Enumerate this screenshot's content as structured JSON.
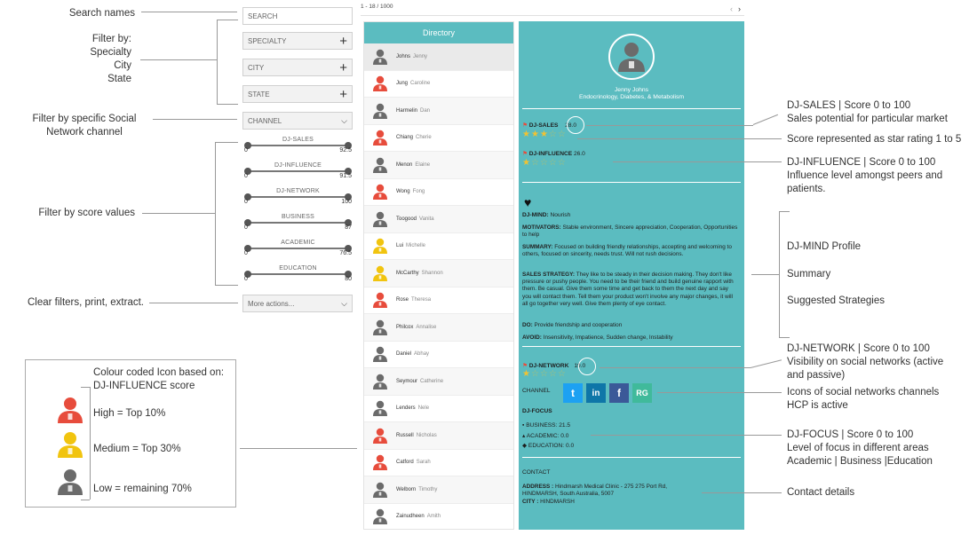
{
  "annotations": {
    "search_names": "Search names",
    "filter_by": "Filter by:",
    "specialty": "Specialty",
    "city": "City",
    "state": "State",
    "filter_channel_1": "Filter by specific Social",
    "filter_channel_2": "Network channel",
    "filter_score": "Filter by score values",
    "clear_filters": "Clear filters, print, extract.",
    "dj_sales_1": "DJ-SALES | Score 0 to 100",
    "dj_sales_2": "Sales potential for particular market",
    "star_rating": "Score represented as star rating 1 to 5",
    "dj_influence_1": "DJ-INFLUENCE | Score 0 to 100",
    "dj_influence_2": "Influence level amongst peers and",
    "dj_influence_3": "patients.",
    "dj_mind_profile": "DJ-MIND Profile",
    "summary": "Summary",
    "suggested": "Suggested Strategies",
    "dj_network_1": "DJ-NETWORK | Score 0 to 100",
    "dj_network_2": "Visibility on social networks (active",
    "dj_network_3": "and passive)",
    "icons_1": "Icons of social networks channels",
    "icons_2": "HCP is active",
    "dj_focus_1": "DJ-FOCUS | Score 0 to 100",
    "dj_focus_2": "Level of focus in different areas",
    "dj_focus_3": "Academic | Business |Education",
    "contact_details": "Contact details"
  },
  "filters": {
    "search_placeholder": "SEARCH",
    "specialty": "SPECIALTY",
    "city": "CITY",
    "state": "STATE",
    "channel": "CHANNEL",
    "more_actions": "More actions..."
  },
  "sliders": [
    {
      "label": "DJ-SALES",
      "min": "0",
      "max": "92.5"
    },
    {
      "label": "DJ-INFLUENCE",
      "min": "0",
      "max": "91.5"
    },
    {
      "label": "DJ-NETWORK",
      "min": "0",
      "max": "100"
    },
    {
      "label": "BUSINESS",
      "min": "0",
      "max": "87"
    },
    {
      "label": "ACADEMIC",
      "min": "0",
      "max": "76.5"
    },
    {
      "label": "EDUCATION",
      "min": "0",
      "max": "80"
    }
  ],
  "pager": {
    "range": "1 - 18 / 1000",
    "prev": "‹",
    "next": "›"
  },
  "directory": {
    "title": "Directory",
    "rows": [
      {
        "first": "Johns",
        "last": "Jenny",
        "color": "#6b6b6b"
      },
      {
        "first": "Jung",
        "last": "Caroline",
        "color": "#e74c3c"
      },
      {
        "first": "Harmelin",
        "last": "Dan",
        "color": "#6b6b6b"
      },
      {
        "first": "Chiang",
        "last": "Cherie",
        "color": "#e74c3c"
      },
      {
        "first": "Menon",
        "last": "Elaine",
        "color": "#6b6b6b"
      },
      {
        "first": "Wong",
        "last": "Fong",
        "color": "#e74c3c"
      },
      {
        "first": "Toogood",
        "last": "Vanita",
        "color": "#6b6b6b"
      },
      {
        "first": "Lui",
        "last": "Michelle",
        "color": "#f1c40f"
      },
      {
        "first": "McCarthy",
        "last": "Shannon",
        "color": "#f1c40f"
      },
      {
        "first": "Rose",
        "last": "Theresa",
        "color": "#e74c3c"
      },
      {
        "first": "Philcox",
        "last": "Annalise",
        "color": "#6b6b6b"
      },
      {
        "first": "Daniel",
        "last": "Abhay",
        "color": "#6b6b6b"
      },
      {
        "first": "Seymour",
        "last": "Catherine",
        "color": "#6b6b6b"
      },
      {
        "first": "Lenders",
        "last": "Nele",
        "color": "#6b6b6b"
      },
      {
        "first": "Russell",
        "last": "Nicholas",
        "color": "#e74c3c"
      },
      {
        "first": "Catford",
        "last": "Sarah",
        "color": "#e74c3c"
      },
      {
        "first": "Welborn",
        "last": "Timothy",
        "color": "#6b6b6b"
      },
      {
        "first": "Zainudheen",
        "last": "Amith",
        "color": "#6b6b6b"
      }
    ]
  },
  "profile": {
    "name": "Jenny Johns",
    "specialty": "Endocrinology, Diabetes, & Metabolism",
    "sales_label": "DJ-SALES",
    "sales_value": "28.0",
    "sales_stars": 3.5,
    "influence_label": "DJ-INFLUENCE",
    "influence_value": "26.0",
    "influence_stars": 1.5,
    "mind_label": "DJ-MIND:",
    "mind_value": "Nourish",
    "motivators_label": "MOTIVATORS:",
    "motivators_value": "Stable environment, Sincere appreciation, Cooperation, Opportunities to help",
    "summary_label": "SUMMARY:",
    "summary_value": "Focused on building friendly relationships, accepting and welcoming to others, focused on sincerity, needs trust. Will not rush decisions.",
    "strategy_label": "SALES STRATEGY:",
    "strategy_value": "They like to be steady in their decision making. They don't like pressure or pushy people. You need to be their friend and build genuine rapport with them. Be casual. Give them some time and get back to them the next day and say you will contact them. Tell them your product won't involve any major changes, it will all go together very well. Give them plenty of eye contact.",
    "do_label": "DO:",
    "do_value": "Provide friendship and cooperation",
    "avoid_label": "AVOID:",
    "avoid_value": "Insensitivity, Impatience, Sudden change, Instability",
    "network_label": "DJ-NETWORK",
    "network_value": "19.0",
    "network_stars": 1,
    "channel_label": "CHANNEL",
    "channels": [
      "Twitter",
      "LinkedIn",
      "Facebook",
      "ResearchGate"
    ],
    "channel_glyphs": [
      "t",
      "in",
      "f",
      "RG"
    ],
    "focus_label": "DJ-FOCUS",
    "business_label": "BUSINESS:",
    "business_value": "21.5",
    "academic_label": "ACADEMIC:",
    "academic_value": "0.0",
    "education_label": "EDUCATION:",
    "education_value": "0.0",
    "contact_label": "CONTACT",
    "address_label": "ADDRESS :",
    "address_value": "Hindmarsh Medical Clinic - 275 275 Port Rd, HINDMARSH, South Australia, 5007",
    "city_label": "CITY :",
    "city_value": "HINDMARSH"
  },
  "legend": {
    "title_1": "Colour coded Icon based on:",
    "title_2": "DJ-INFLUENCE score",
    "high": "High = Top 10%",
    "medium": "Medium = Top 30%",
    "low": "Low = remaining 70%",
    "high_color": "#e74c3c",
    "medium_color": "#f1c40f",
    "low_color": "#6b6b6b"
  },
  "colors": {
    "accent": "#5bbcc0",
    "star": "#f1c232",
    "twitter": "#1da1f2",
    "linkedin": "#0e76a8",
    "facebook": "#3b5998",
    "researchgate": "#40ba9b"
  }
}
